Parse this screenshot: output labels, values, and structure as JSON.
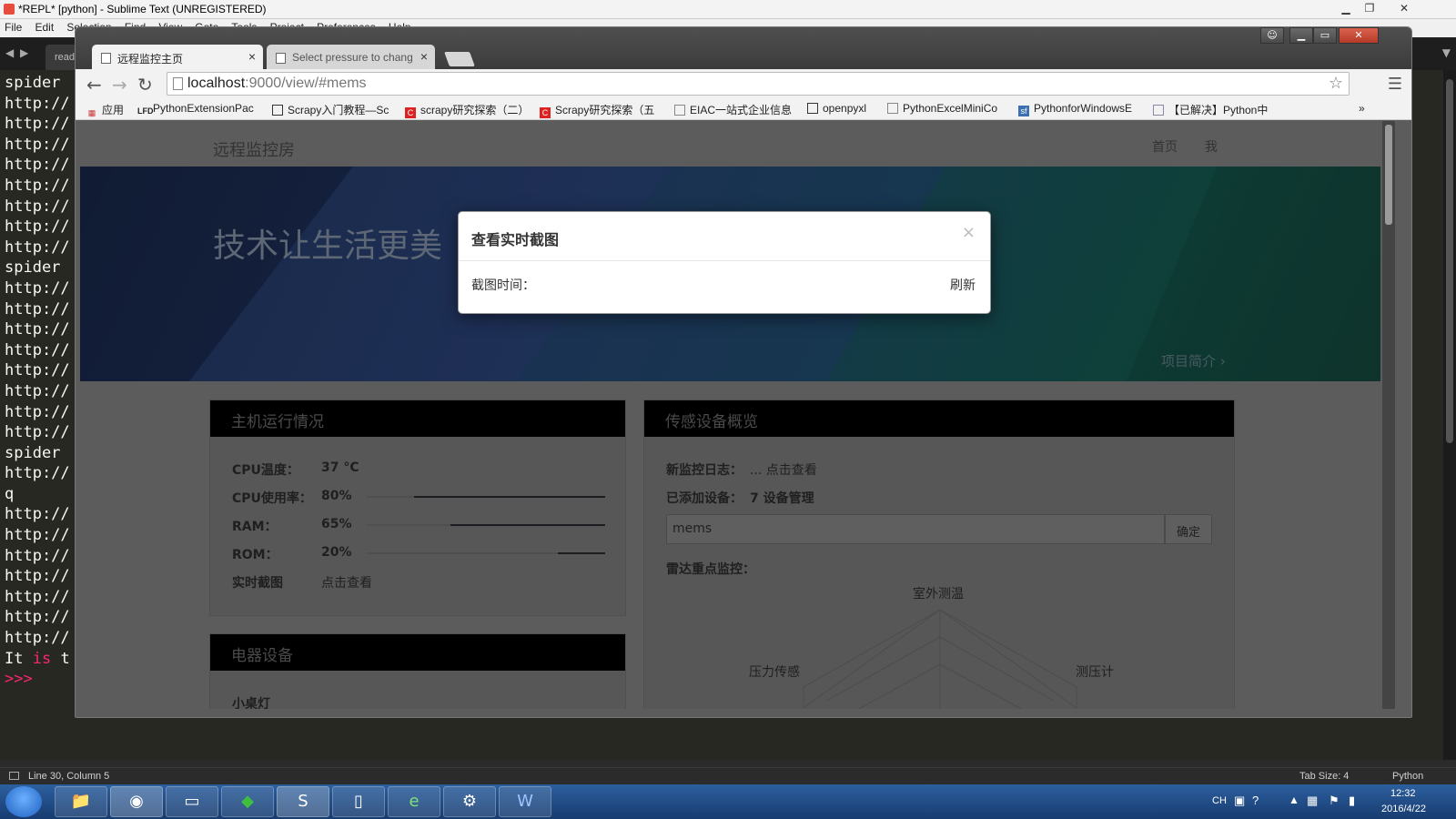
{
  "sublime": {
    "title": "*REPL* [python] - Sublime Text (UNREGISTERED)",
    "menu": [
      "File",
      "Edit",
      "Selection",
      "Find",
      "View",
      "Goto",
      "Tools",
      "Project",
      "Preferences",
      "Help"
    ],
    "tab_label": "read",
    "lines": [
      "spider",
      "http://",
      "http://",
      "http://",
      "http://",
      "http://",
      "http://",
      "http://",
      "http://",
      "spider",
      "http://",
      "http://",
      "http://",
      "http://",
      "http://",
      "http://",
      "http://",
      "http://",
      "spider",
      "http://",
      "q",
      "http://",
      "http://",
      "http://",
      "http://",
      "http://",
      "http://",
      "http://"
    ],
    "last_line": [
      "It ",
      "is",
      " t"
    ],
    "prompt": ">>>",
    "status_position": "Line 30, Column 5",
    "status_tab": "Tab Size: 4",
    "status_syntax": "Python"
  },
  "taskbar": {
    "clock_time": "12:32",
    "clock_date": "2016/4/22",
    "lang": "CH",
    "apps": [
      "explorer",
      "chrome",
      "cmd",
      "feng",
      "sublime",
      "notepad",
      "ie",
      "shell",
      "word"
    ]
  },
  "browser": {
    "tabs": [
      {
        "label": "远程监控主页",
        "close": "×"
      },
      {
        "label": "Select pressure to chang",
        "close": "×"
      }
    ],
    "url_host": "localhost",
    "url_path": ":9000/view/#mems",
    "bookmarks": [
      "应用",
      "PythonExtensionPac",
      "Scrapy入门教程—Sc",
      "scrapy研究探索（二）",
      "Scrapy研究探索（五",
      "EIAC一站式企业信息",
      "openpyxl",
      "PythonExcelMiniCo",
      "PythonforWindowsE",
      "【已解决】Python中"
    ],
    "bookmarks_more": "»"
  },
  "page": {
    "brand": "远程监控房",
    "nav": [
      "首页",
      "我"
    ],
    "hero_title": "技术让生活更美",
    "hero_link": "项目简介",
    "host_panel": {
      "title": "主机运行情况",
      "rows": [
        {
          "label": "CPU温度：",
          "value": "37 °C"
        },
        {
          "label": "CPU使用率：",
          "value": "80%",
          "level": 0.8
        },
        {
          "label": "RAM：",
          "value": "65%",
          "level": 0.65
        },
        {
          "label": "ROM：",
          "value": "20%",
          "level": 0.2
        },
        {
          "label": "实时截图",
          "value": "点击查看"
        }
      ]
    },
    "device_panel": {
      "title": "电器设备",
      "first_item": "小桌灯"
    },
    "sensor_panel": {
      "title": "传感设备概览",
      "log_label": "新监控日志：",
      "log_value": "... 点击查看",
      "added_label": "已添加设备：",
      "added_value": "7 设备管理",
      "input_value": "mems",
      "confirm": "确定",
      "radar_label": "雷达重点监控：",
      "radar_axes": [
        "室外测温",
        "压力传感",
        "测压计"
      ]
    }
  },
  "modal": {
    "title": "查看实时截图",
    "close": "×",
    "time_label": "截图时间：",
    "refresh": "刷新"
  }
}
